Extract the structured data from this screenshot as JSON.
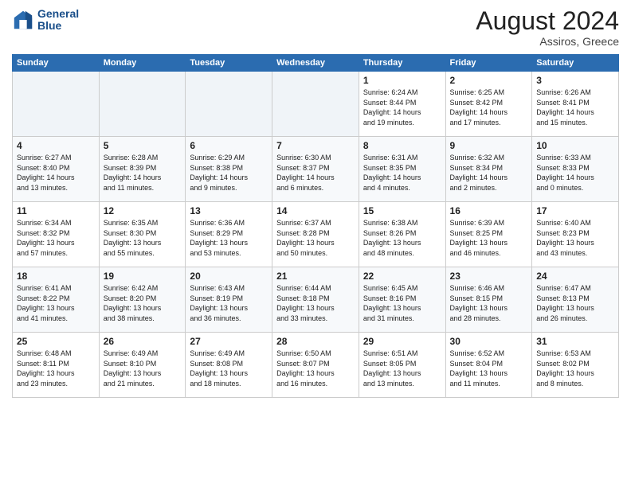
{
  "logo": {
    "line1": "General",
    "line2": "Blue"
  },
  "header": {
    "month": "August 2024",
    "location": "Assiros, Greece"
  },
  "weekdays": [
    "Sunday",
    "Monday",
    "Tuesday",
    "Wednesday",
    "Thursday",
    "Friday",
    "Saturday"
  ],
  "weeks": [
    [
      {
        "day": "",
        "info": ""
      },
      {
        "day": "",
        "info": ""
      },
      {
        "day": "",
        "info": ""
      },
      {
        "day": "",
        "info": ""
      },
      {
        "day": "1",
        "info": "Sunrise: 6:24 AM\nSunset: 8:44 PM\nDaylight: 14 hours\nand 19 minutes."
      },
      {
        "day": "2",
        "info": "Sunrise: 6:25 AM\nSunset: 8:42 PM\nDaylight: 14 hours\nand 17 minutes."
      },
      {
        "day": "3",
        "info": "Sunrise: 6:26 AM\nSunset: 8:41 PM\nDaylight: 14 hours\nand 15 minutes."
      }
    ],
    [
      {
        "day": "4",
        "info": "Sunrise: 6:27 AM\nSunset: 8:40 PM\nDaylight: 14 hours\nand 13 minutes."
      },
      {
        "day": "5",
        "info": "Sunrise: 6:28 AM\nSunset: 8:39 PM\nDaylight: 14 hours\nand 11 minutes."
      },
      {
        "day": "6",
        "info": "Sunrise: 6:29 AM\nSunset: 8:38 PM\nDaylight: 14 hours\nand 9 minutes."
      },
      {
        "day": "7",
        "info": "Sunrise: 6:30 AM\nSunset: 8:37 PM\nDaylight: 14 hours\nand 6 minutes."
      },
      {
        "day": "8",
        "info": "Sunrise: 6:31 AM\nSunset: 8:35 PM\nDaylight: 14 hours\nand 4 minutes."
      },
      {
        "day": "9",
        "info": "Sunrise: 6:32 AM\nSunset: 8:34 PM\nDaylight: 14 hours\nand 2 minutes."
      },
      {
        "day": "10",
        "info": "Sunrise: 6:33 AM\nSunset: 8:33 PM\nDaylight: 14 hours\nand 0 minutes."
      }
    ],
    [
      {
        "day": "11",
        "info": "Sunrise: 6:34 AM\nSunset: 8:32 PM\nDaylight: 13 hours\nand 57 minutes."
      },
      {
        "day": "12",
        "info": "Sunrise: 6:35 AM\nSunset: 8:30 PM\nDaylight: 13 hours\nand 55 minutes."
      },
      {
        "day": "13",
        "info": "Sunrise: 6:36 AM\nSunset: 8:29 PM\nDaylight: 13 hours\nand 53 minutes."
      },
      {
        "day": "14",
        "info": "Sunrise: 6:37 AM\nSunset: 8:28 PM\nDaylight: 13 hours\nand 50 minutes."
      },
      {
        "day": "15",
        "info": "Sunrise: 6:38 AM\nSunset: 8:26 PM\nDaylight: 13 hours\nand 48 minutes."
      },
      {
        "day": "16",
        "info": "Sunrise: 6:39 AM\nSunset: 8:25 PM\nDaylight: 13 hours\nand 46 minutes."
      },
      {
        "day": "17",
        "info": "Sunrise: 6:40 AM\nSunset: 8:23 PM\nDaylight: 13 hours\nand 43 minutes."
      }
    ],
    [
      {
        "day": "18",
        "info": "Sunrise: 6:41 AM\nSunset: 8:22 PM\nDaylight: 13 hours\nand 41 minutes."
      },
      {
        "day": "19",
        "info": "Sunrise: 6:42 AM\nSunset: 8:20 PM\nDaylight: 13 hours\nand 38 minutes."
      },
      {
        "day": "20",
        "info": "Sunrise: 6:43 AM\nSunset: 8:19 PM\nDaylight: 13 hours\nand 36 minutes."
      },
      {
        "day": "21",
        "info": "Sunrise: 6:44 AM\nSunset: 8:18 PM\nDaylight: 13 hours\nand 33 minutes."
      },
      {
        "day": "22",
        "info": "Sunrise: 6:45 AM\nSunset: 8:16 PM\nDaylight: 13 hours\nand 31 minutes."
      },
      {
        "day": "23",
        "info": "Sunrise: 6:46 AM\nSunset: 8:15 PM\nDaylight: 13 hours\nand 28 minutes."
      },
      {
        "day": "24",
        "info": "Sunrise: 6:47 AM\nSunset: 8:13 PM\nDaylight: 13 hours\nand 26 minutes."
      }
    ],
    [
      {
        "day": "25",
        "info": "Sunrise: 6:48 AM\nSunset: 8:11 PM\nDaylight: 13 hours\nand 23 minutes."
      },
      {
        "day": "26",
        "info": "Sunrise: 6:49 AM\nSunset: 8:10 PM\nDaylight: 13 hours\nand 21 minutes."
      },
      {
        "day": "27",
        "info": "Sunrise: 6:49 AM\nSunset: 8:08 PM\nDaylight: 13 hours\nand 18 minutes."
      },
      {
        "day": "28",
        "info": "Sunrise: 6:50 AM\nSunset: 8:07 PM\nDaylight: 13 hours\nand 16 minutes."
      },
      {
        "day": "29",
        "info": "Sunrise: 6:51 AM\nSunset: 8:05 PM\nDaylight: 13 hours\nand 13 minutes."
      },
      {
        "day": "30",
        "info": "Sunrise: 6:52 AM\nSunset: 8:04 PM\nDaylight: 13 hours\nand 11 minutes."
      },
      {
        "day": "31",
        "info": "Sunrise: 6:53 AM\nSunset: 8:02 PM\nDaylight: 13 hours\nand 8 minutes."
      }
    ]
  ]
}
